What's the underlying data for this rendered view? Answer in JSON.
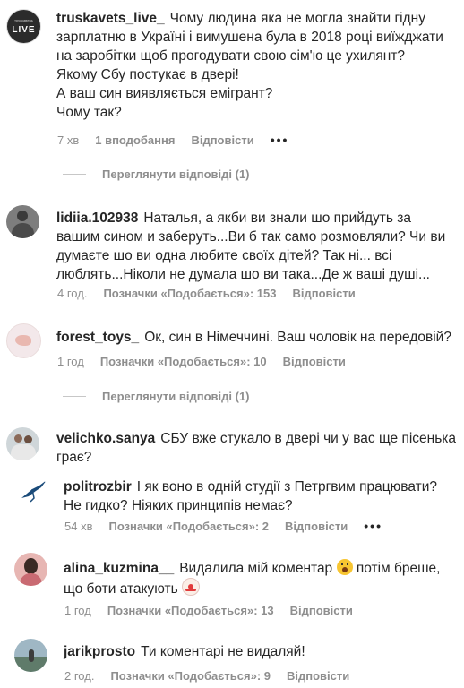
{
  "comments": [
    {
      "username": "truskavets_live_",
      "avatar_text": "LIVE",
      "avatar_top": "трускавець",
      "text": "Чому людина яка не могла знайти гідну\nзарплатню в Україні і вимушена була в 2018 році виїжджати\nна заробітки щоб прогодувати свою сім'ю це ухилянт?\nЯкому Сбу постукає в двері!\nА ваш син виявляється емігрант?\nЧому так?",
      "time": "7 хв",
      "likes": "1 вподобання",
      "reply": "Відповісти",
      "more": "•••",
      "view_replies": "Переглянути відповіді (1)"
    },
    {
      "username": "lidiia.102938",
      "text": "Наталья, а якби ви знали шо прийдуть за\nвашим сином и заберуть...Ви б так само розмовляли? Чи ви\nдумаєте шо ви одна любите своїх дітей? Так ні... всі\nлюблять...Ніколи не думала шо ви така...Де ж ваші душі...",
      "time": "4 год.",
      "likes": "Позначки «Подобається»: 153",
      "reply": "Відповісти"
    },
    {
      "username": "forest_toys_",
      "text": "Ок, син в Німеччині. Ваш чоловік на передовій?",
      "time": "1 год",
      "likes": "Позначки «Подобається»: 10",
      "reply": "Відповісти",
      "view_replies": "Переглянути відповіді (1)"
    },
    {
      "username": "velichko.sanya",
      "text": "СБУ вже стукало в двері чи у вас ще пісенька\nграє?"
    },
    {
      "username": "politrozbir",
      "text": "І як воно в одній студії з Петргвим працювати?\nНе гидко? Ніяких принципів немає?",
      "time": "54 хв",
      "likes": "Позначки «Подобається»: 2",
      "reply": "Відповісти",
      "more": "•••"
    },
    {
      "username": "alina_kuzmina__",
      "text_before": "Видалила мій коментар",
      "text_mid": "потім бреше,\nщо боти атакують",
      "time": "1 год",
      "likes": "Позначки «Подобається»: 13",
      "reply": "Відповісти"
    },
    {
      "username": "jarikprosto",
      "text": "Ти коментарі не видаляй!",
      "time": "2 год.",
      "likes": "Позначки «Подобається»: 9",
      "reply": "Відповісти"
    }
  ]
}
